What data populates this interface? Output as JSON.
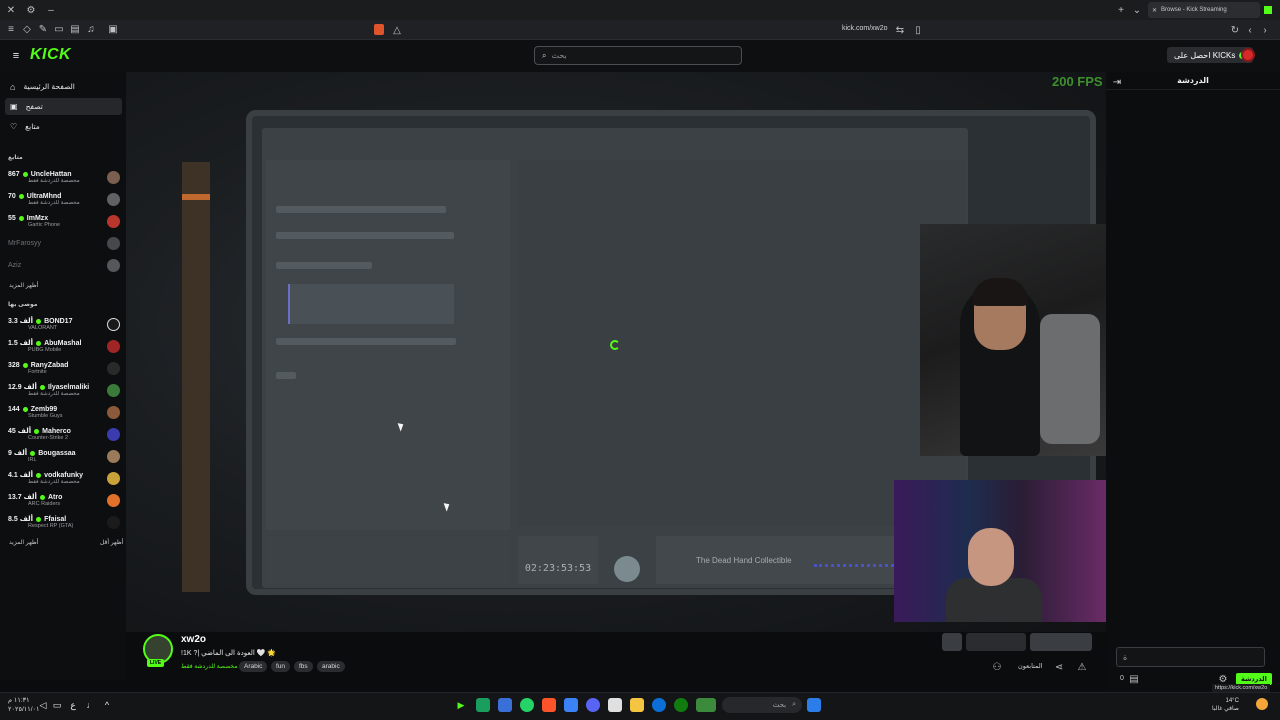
{
  "browser": {
    "tab_title": "Browse - Kick Streaming",
    "url": "kick.com/xw2o",
    "tooltip_url": "https://kick.com/xw2o"
  },
  "header": {
    "logo": "KICK",
    "search_placeholder": "بحث",
    "get_kicks": "احصل على KICKs"
  },
  "sidebar": {
    "nav": [
      {
        "label": "الصفحة الرئيسية",
        "icon": "home-icon"
      },
      {
        "label": "تصفح",
        "icon": "browse-icon"
      },
      {
        "label": "متابع",
        "icon": "heart-icon"
      }
    ],
    "following_title": "متابع",
    "following": [
      {
        "name": "UncleHattan",
        "viewers": "867",
        "category": "مخصصة للدردشة فقط",
        "live": true
      },
      {
        "name": "UltraMhnd",
        "viewers": "70",
        "category": "مخصصة للدردشة فقط",
        "live": true
      },
      {
        "name": "ImMzx",
        "viewers": "55",
        "category": "Gartic Phone",
        "live": true
      },
      {
        "name": "MrFarosyy",
        "viewers": "",
        "category": "",
        "live": false
      },
      {
        "name": "Aziz",
        "viewers": "",
        "category": "",
        "live": false
      }
    ],
    "show_more": "أظهر المزيد",
    "recommended_title": "موصى بها",
    "recommended": [
      {
        "name": "BOND17",
        "viewers": "3.3 ألف",
        "category": "VALORANT"
      },
      {
        "name": "AbuMashal",
        "viewers": "1.5 ألف",
        "category": "PUBG Mobile"
      },
      {
        "name": "RanyZabad",
        "viewers": "328",
        "category": "Fortnite"
      },
      {
        "name": "Ilyaselmaliki",
        "viewers": "12.9 ألف",
        "category": "مخصصة للدردشة فقط"
      },
      {
        "name": "Zemb99",
        "viewers": "144",
        "category": "Stumble Guys"
      },
      {
        "name": "Maherco",
        "viewers": "45 ألف",
        "category": "Counter-Strike 2"
      },
      {
        "name": "Bougassaa",
        "viewers": "9 ألف",
        "category": "IRL"
      },
      {
        "name": "vodkafunky",
        "viewers": "4.1 ألف",
        "category": "مخصصة للدردشة فقط"
      },
      {
        "name": "Atro",
        "viewers": "13.7 ألف",
        "category": "ARC Raiders"
      },
      {
        "name": "Ffaisal",
        "viewers": "8.5 ألف",
        "category": "Respect RP (GTA)"
      }
    ],
    "show_more_2": "أظهر المزيد",
    "show_less": "أظهر أقل"
  },
  "player": {
    "fps": "200 FPS",
    "timer": "02:23:53:53",
    "game_item": "The Dead Hand Collectible"
  },
  "stream": {
    "streamer": "xw2o",
    "live_badge": "LIVE",
    "title": "!1K ?| العودة الى الماضي 🤍 🌟",
    "category": "مخصصة للدردشة فقط",
    "tags": [
      "Arabic",
      "fun",
      "fbs",
      "arabic"
    ],
    "followers_label": "المتابعون"
  },
  "chat": {
    "title": "الدردشة",
    "input_value": "ة",
    "send_label": "الدردشة",
    "count": "0"
  },
  "taskbar": {
    "search": "بحث",
    "time": "١١:٣١ م",
    "date": "٢٠٢٥/١١/٠١",
    "weather_temp": "14°C",
    "weather_desc": "صافي غالبا",
    "lang": "ع"
  },
  "colors": {
    "accent": "#53fc18",
    "background": "#0b0c0d",
    "sidebar": "#0d0e0f"
  }
}
